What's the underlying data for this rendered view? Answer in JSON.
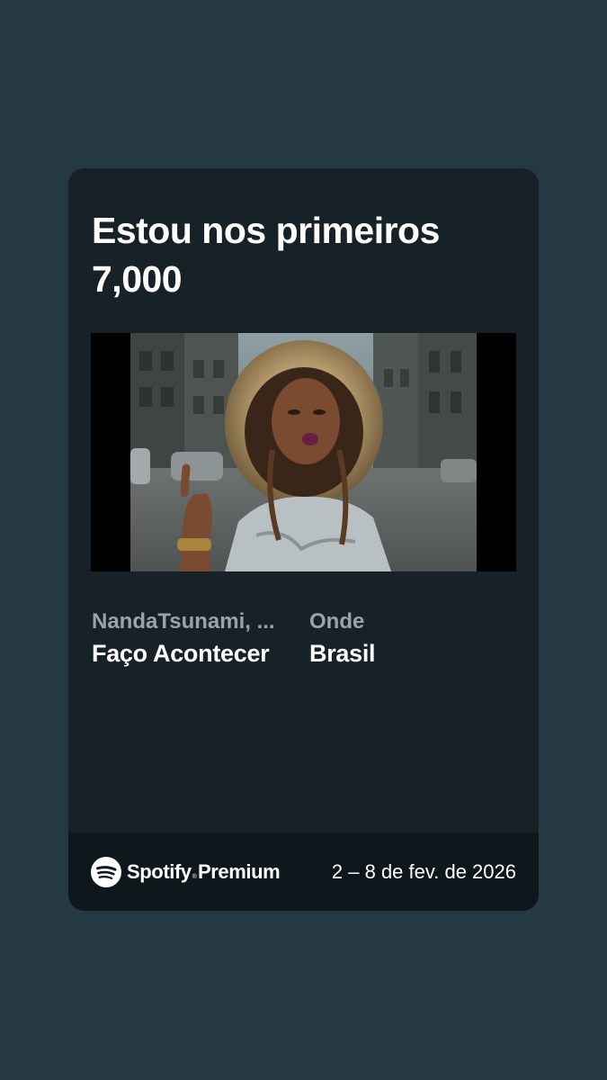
{
  "card": {
    "title": "Estou nos primeiros 7,000",
    "video": {
      "description_icon": "video-still"
    },
    "track": {
      "artist": "NandaTsunami, ...",
      "song": "Faço Acontecer"
    },
    "location": {
      "label": "Onde",
      "value": "Brasil"
    }
  },
  "footer": {
    "brand_name": "Spotify",
    "brand_mark": "®",
    "tier": "Premium",
    "date_range": "2 – 8 de fev. de 2026",
    "icon": "spotify-logo-icon"
  },
  "colors": {
    "background": "#253943",
    "card": "#162128",
    "footer": "#0e171c",
    "muted_text": "#9aa3a8",
    "text": "#ffffff"
  }
}
